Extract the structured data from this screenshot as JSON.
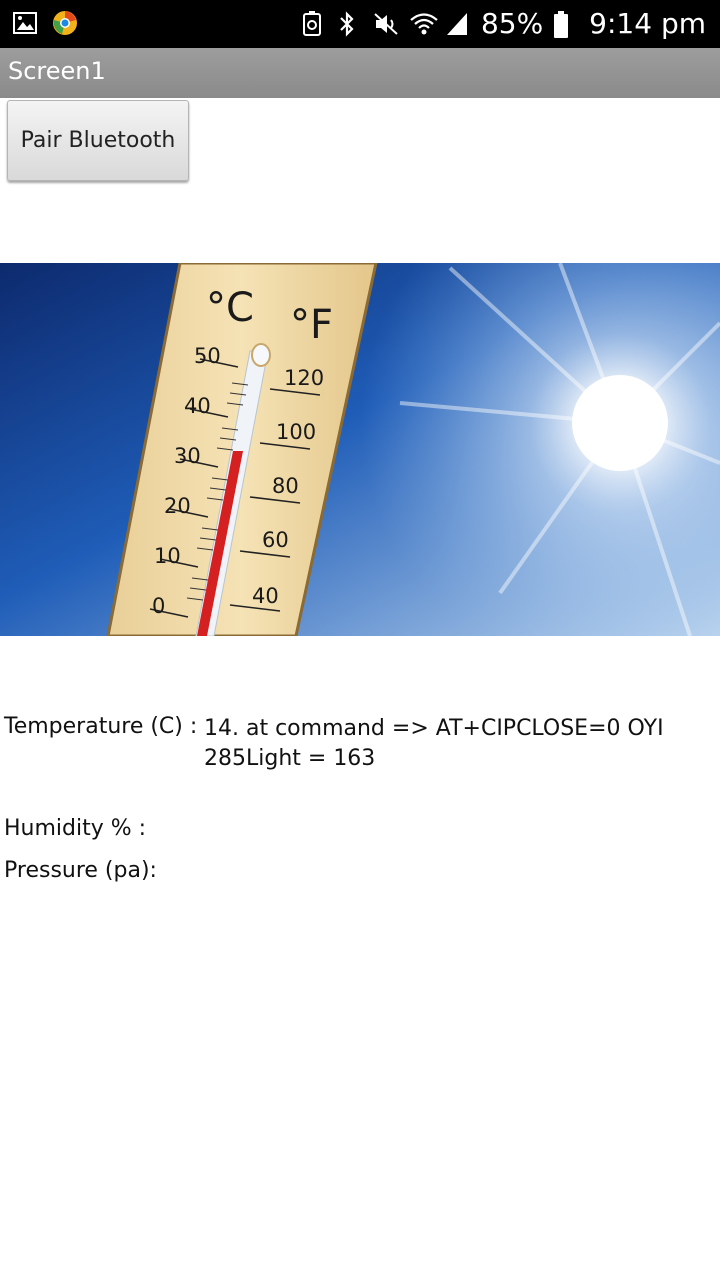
{
  "status_bar": {
    "battery": "85%",
    "time": "9:14 pm",
    "icons": [
      "image-icon",
      "chrome-icon",
      "battery-saver-icon",
      "bluetooth-icon",
      "mute-icon",
      "wifi-icon",
      "signal-icon",
      "battery-icon"
    ]
  },
  "title_bar": {
    "title": "Screen1"
  },
  "bluetooth": {
    "button_label": "Pair Bluetooth"
  },
  "thermometer_image": {
    "celsius_label": "°C",
    "fahrenheit_label": "°F",
    "celsius_ticks": [
      "50",
      "40",
      "30",
      "20",
      "10",
      "0"
    ],
    "fahrenheit_ticks": [
      "120",
      "100",
      "80",
      "60",
      "40"
    ]
  },
  "readings": {
    "temperature_label": "Temperature (C) :",
    "temperature_value_line1": "14. at command => AT+CIPCLOSE=0 OYI",
    "temperature_value_line2": "285Light = 163",
    "humidity_label": "Humidity % :",
    "pressure_label": "Pressure (pa):"
  }
}
